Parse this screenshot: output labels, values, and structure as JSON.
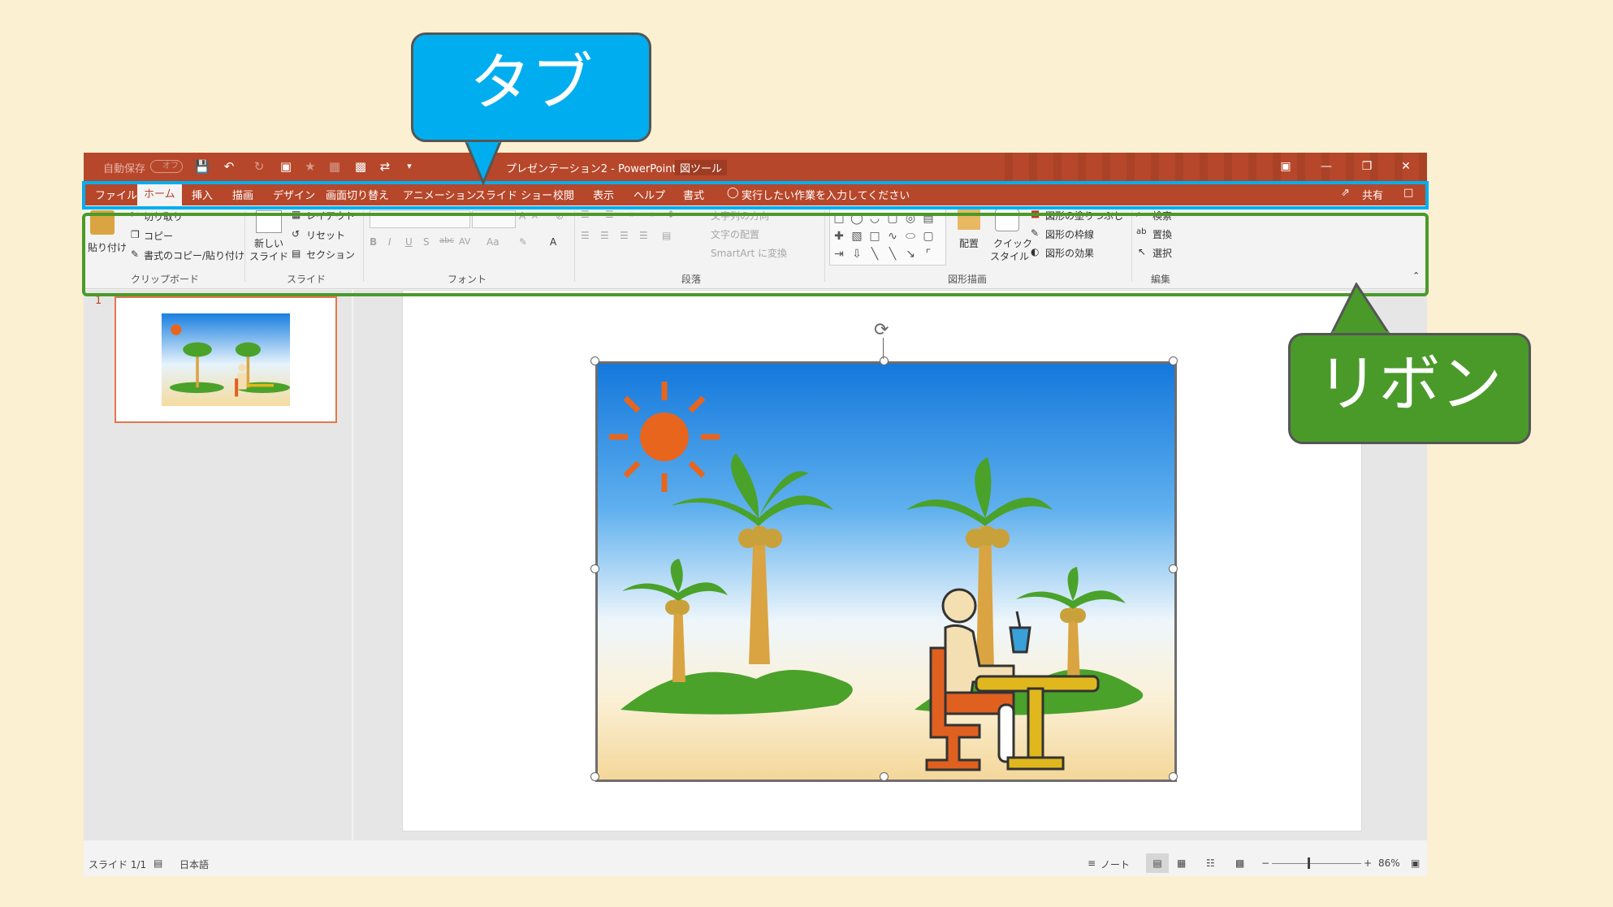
{
  "titlebar": {
    "autosave_label": "自動保存",
    "autosave_state": "オフ",
    "title": "プレゼンテーション2 - PowerPoint",
    "contextual_group": "図ツール"
  },
  "tabs": [
    "ファイル",
    "ホーム",
    "挿入",
    "描画",
    "デザイン",
    "画面切り替え",
    "アニメーション",
    "スライド ショー",
    "校閲",
    "表示",
    "ヘルプ",
    "書式"
  ],
  "active_tab": "ホーム",
  "tell_me": "実行したい作業を入力してください",
  "share": "共有",
  "ribbon": {
    "clipboard": {
      "paste": "貼り付け",
      "cut": "切り取り",
      "copy": "コピー",
      "format_painter": "書式のコピー/貼り付け",
      "label": "クリップボード"
    },
    "slides": {
      "new_slide_1": "新しい",
      "new_slide_2": "スライド",
      "layout": "レイアウト",
      "reset": "リセット",
      "section": "セクション",
      "label": "スライド"
    },
    "font": {
      "label": "フォント",
      "size_up": "A",
      "size_down": "A",
      "bold": "B",
      "italic": "I",
      "underline": "U",
      "shadow": "S",
      "strike": "abc",
      "spacing": "AV",
      "case": "Aa",
      "color": "A"
    },
    "paragraph": {
      "text_direction": "文字列の方向",
      "align_text": "文字の配置",
      "smartart": "SmartArt に変換",
      "label": "段落"
    },
    "drawing": {
      "arrange": "配置",
      "quick_styles_1": "クイック",
      "quick_styles_2": "スタイル",
      "fill": "図形の塗りつぶし",
      "outline": "図形の枠線",
      "effects": "図形の効果",
      "label": "図形描画"
    },
    "editing": {
      "find": "検索",
      "replace": "置換",
      "select": "選択",
      "label": "編集"
    }
  },
  "slide_panel": {
    "number": "1"
  },
  "status": {
    "slide_info": "スライド 1/1",
    "language": "日本語",
    "notes": "ノート",
    "zoom": "86%"
  },
  "callouts": {
    "tab": "タブ",
    "ribbon": "リボン"
  },
  "colors": {
    "accent": "#b7472a",
    "tab_callout": "#00aeef",
    "ribbon_callout": "#4a9a2a",
    "background": "#fbf0d2"
  }
}
